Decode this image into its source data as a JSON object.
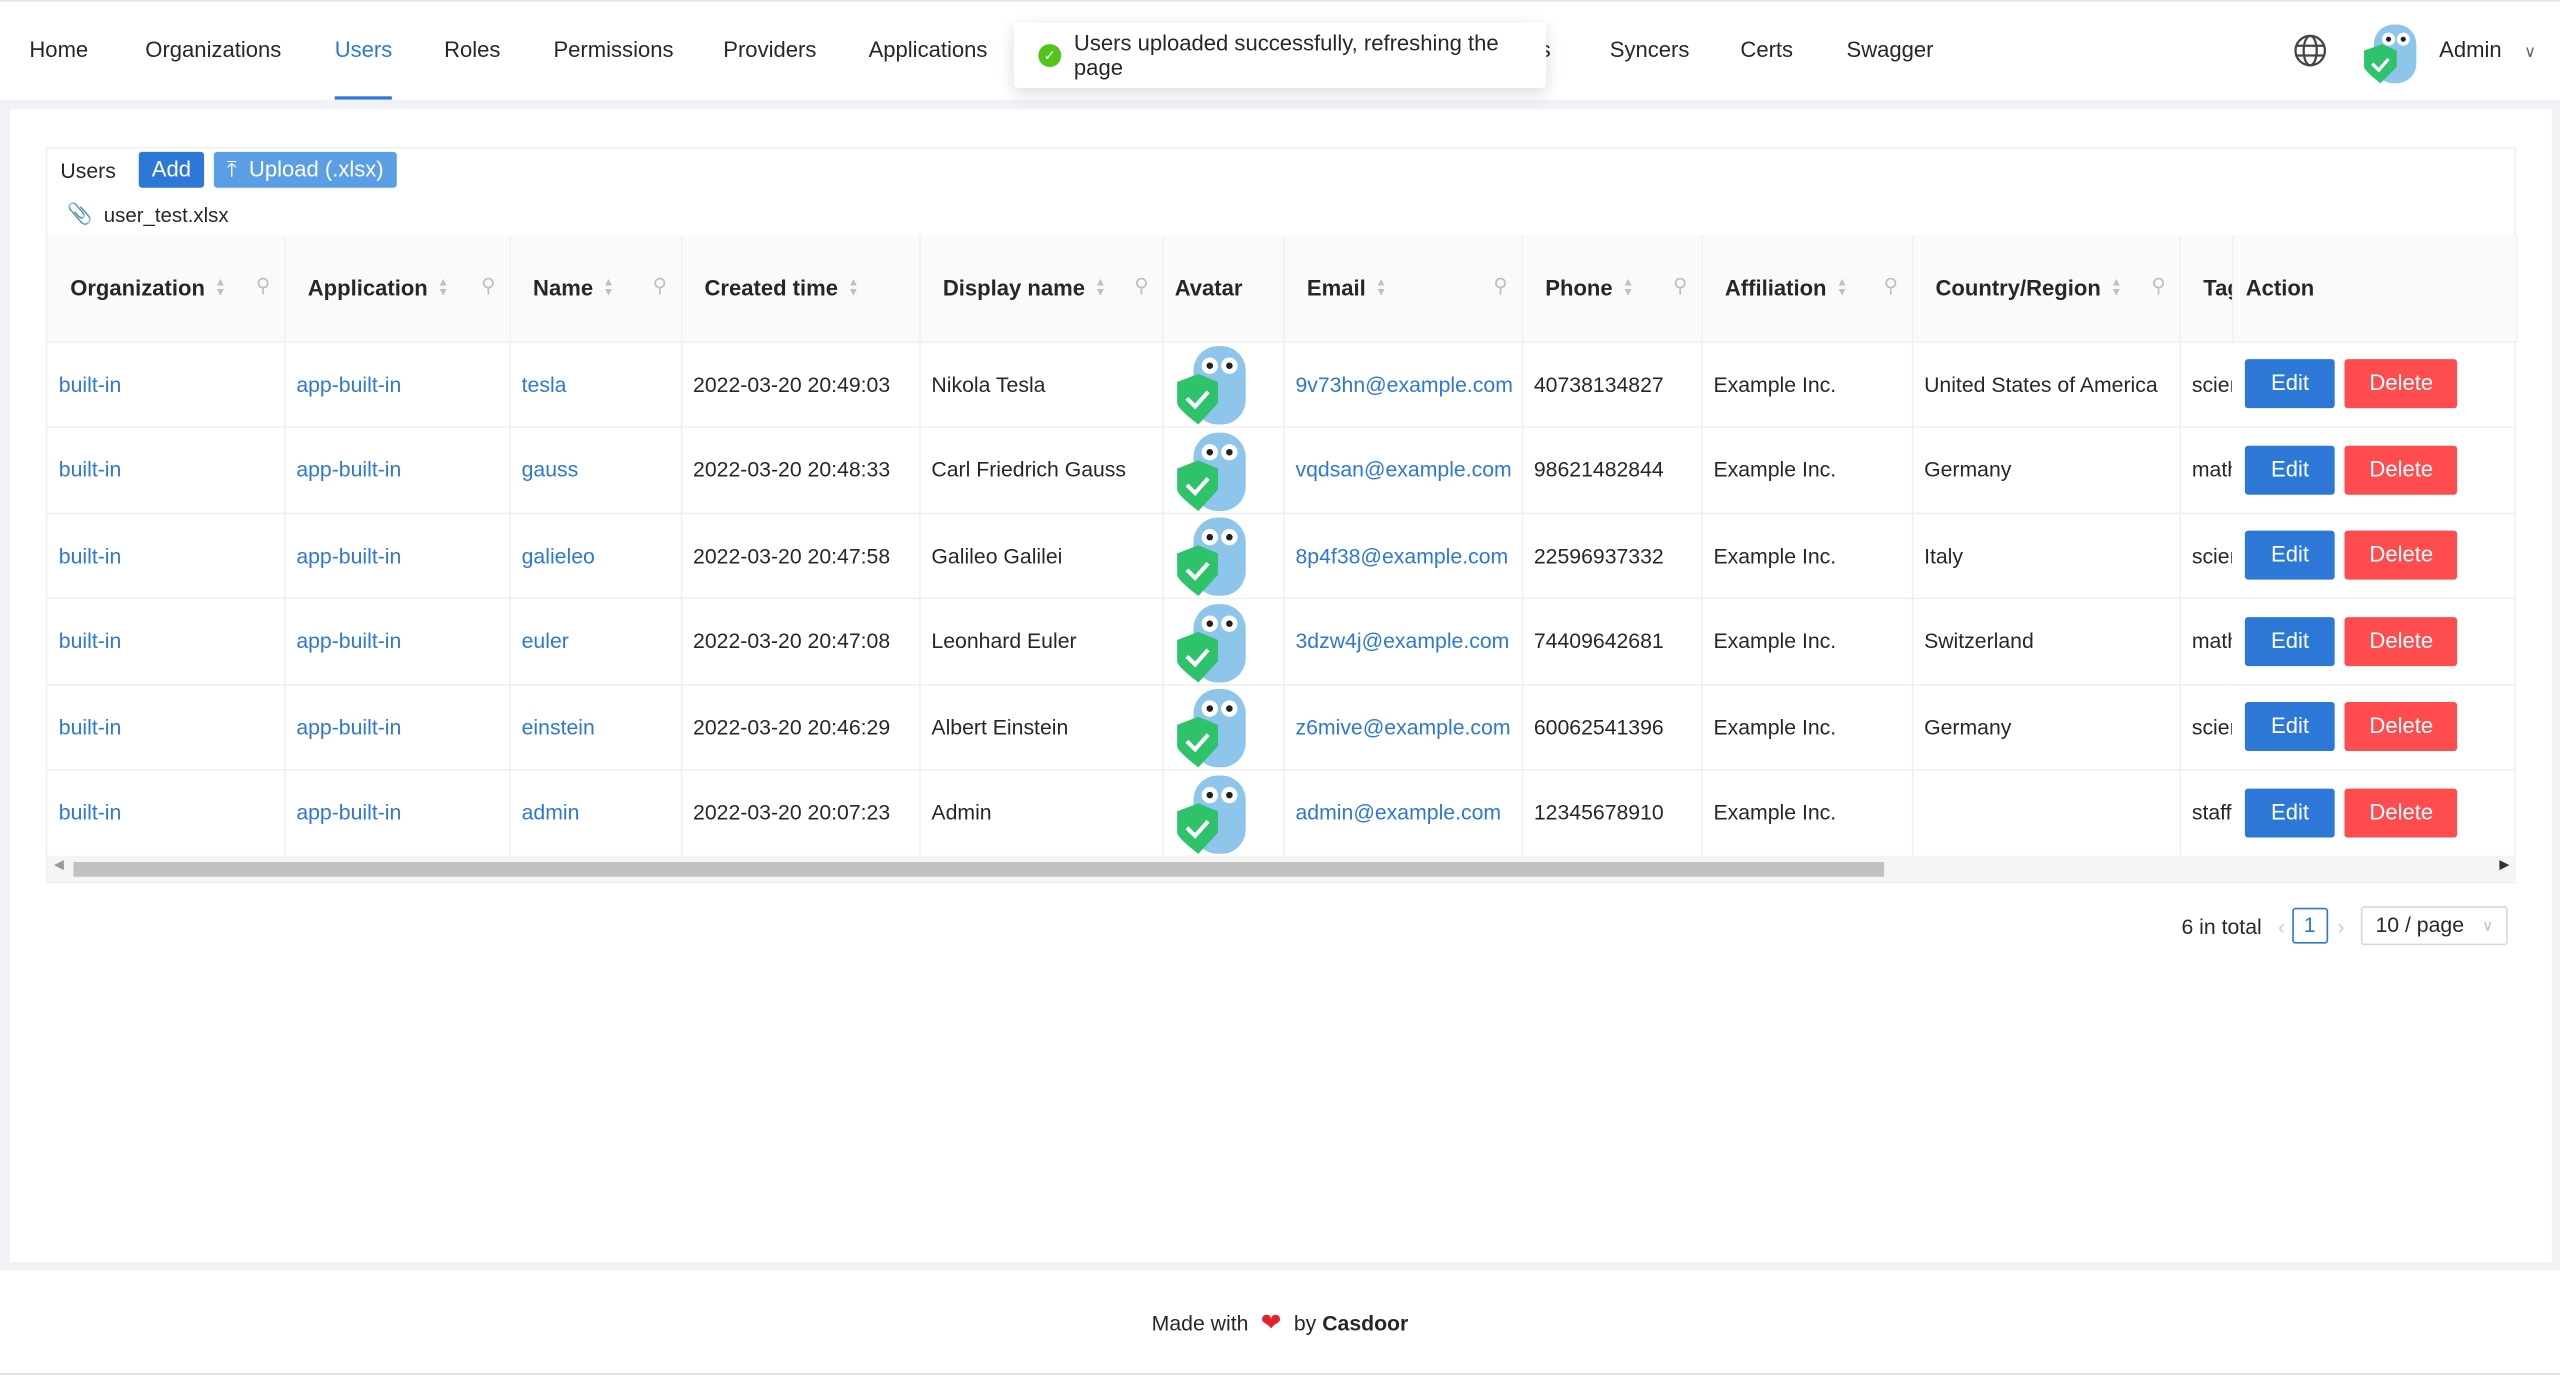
{
  "nav": {
    "items": [
      "Home",
      "Organizations",
      "Users",
      "Roles",
      "Permissions",
      "Providers",
      "Applications",
      "s",
      "Syncers",
      "Certs",
      "Swagger"
    ],
    "active": "Users",
    "user": "Admin"
  },
  "toast": {
    "message": "Users uploaded successfully, refreshing the page",
    "icon": "check-circle-icon"
  },
  "toolbar": {
    "title": "Users",
    "add_label": "Add",
    "upload_label": "Upload (.xlsx)",
    "file_name": "user_test.xlsx"
  },
  "table": {
    "columns": [
      "Organization",
      "Application",
      "Name",
      "Created time",
      "Display name",
      "Avatar",
      "Email",
      "Phone",
      "Affiliation",
      "Country/Region",
      "Tag",
      "Action"
    ],
    "rows": [
      {
        "organization": "built-in",
        "application": "app-built-in",
        "name": "tesla",
        "created": "2022-03-20 20:49:03",
        "display": "Nikola Tesla",
        "email": "9v73hn@example.com",
        "phone": "40738134827",
        "affiliation": "Example Inc.",
        "country": "United States of America",
        "tag": "scientist"
      },
      {
        "organization": "built-in",
        "application": "app-built-in",
        "name": "gauss",
        "created": "2022-03-20 20:48:33",
        "display": "Carl Friedrich Gauss",
        "email": "vqdsan@example.com",
        "phone": "98621482844",
        "affiliation": "Example Inc.",
        "country": "Germany",
        "tag": "mathematician"
      },
      {
        "organization": "built-in",
        "application": "app-built-in",
        "name": "galieleo",
        "created": "2022-03-20 20:47:58",
        "display": "Galileo Galilei",
        "email": "8p4f38@example.com",
        "phone": "22596937332",
        "affiliation": "Example Inc.",
        "country": "Italy",
        "tag": "scientist"
      },
      {
        "organization": "built-in",
        "application": "app-built-in",
        "name": "euler",
        "created": "2022-03-20 20:47:08",
        "display": "Leonhard Euler",
        "email": "3dzw4j@example.com",
        "phone": "74409642681",
        "affiliation": "Example Inc.",
        "country": "Switzerland",
        "tag": "mathematician"
      },
      {
        "organization": "built-in",
        "application": "app-built-in",
        "name": "einstein",
        "created": "2022-03-20 20:46:29",
        "display": "Albert Einstein",
        "email": "z6mive@example.com",
        "phone": "60062541396",
        "affiliation": "Example Inc.",
        "country": "Germany",
        "tag": "scientist"
      },
      {
        "organization": "built-in",
        "application": "app-built-in",
        "name": "admin",
        "created": "2022-03-20 20:07:23",
        "display": "Admin",
        "email": "admin@example.com",
        "phone": "12345678910",
        "affiliation": "Example Inc.",
        "country": "",
        "tag": "staff"
      }
    ],
    "edit_label": "Edit",
    "delete_label": "Delete"
  },
  "pagination": {
    "total": "6 in total",
    "page": "1",
    "page_size": "10 / page"
  },
  "footer": {
    "prefix": "Made with",
    "middle": "by",
    "brand": "Casdoor"
  },
  "colors": {
    "primary": "#2d78d6",
    "danger": "#ff4d4f",
    "upload": "#5a9ee6",
    "success": "#52c41a"
  }
}
